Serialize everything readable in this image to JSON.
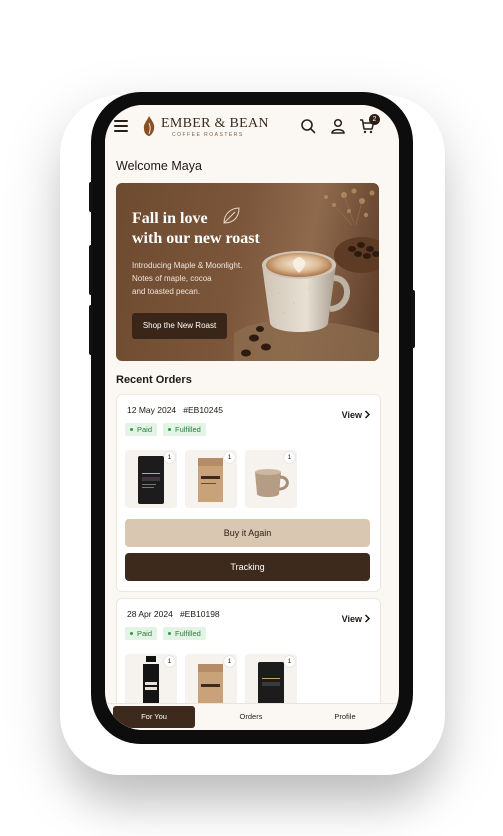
{
  "header": {
    "brand": "EMBER & BEAN",
    "brand_sub": "COFFEE ROASTERS",
    "cart_count": "2",
    "icons": [
      "menu-icon",
      "search-icon",
      "user-icon",
      "cart-icon"
    ]
  },
  "welcome": "Welcome Maya",
  "hero": {
    "title_line1": "Fall in love",
    "title_line2": "with our new roast",
    "desc_line1": "Introducing Maple & Moonlight.",
    "desc_line2": "Notes of maple, cocoa",
    "desc_line3": "and toasted pecan.",
    "button": "Shop the New Roast"
  },
  "recent_orders_title": "Recent Orders",
  "orders": [
    {
      "date": "12 May 2024",
      "number": "#EB10245",
      "view": "View",
      "badges": [
        "Paid",
        "Fulfilled"
      ],
      "items": [
        {
          "qty": "1",
          "label_top": "EMBER & BEAN",
          "label": "MAPLE & MOONLIGHT"
        },
        {
          "qty": "1",
          "label_top": "EMBER & BEAN",
          "label": "OAT LATTE"
        },
        {
          "qty": "1"
        }
      ],
      "buy_again": "Buy it Again",
      "tracking": "Tracking"
    },
    {
      "date": "28 Apr 2024",
      "number": "#EB10198",
      "view": "View",
      "badges": [
        "Paid",
        "Fulfilled"
      ],
      "items": [
        {
          "qty": "1",
          "label_top": "EMBER & BEAN",
          "label": "COLD BREW"
        },
        {
          "qty": "1",
          "label_top": "EMBER & BEAN",
          "label": "HOUSE BLEND"
        },
        {
          "qty": "1",
          "label_top": "EMBER & BEAN",
          "label": "ESPRESSO"
        }
      ]
    }
  ],
  "nav": {
    "for_you": "For You",
    "orders": "Orders",
    "profile": "Profile"
  },
  "colors": {
    "brand_dark": "#3d2a1c",
    "accent_tan": "#d9c7b2",
    "success": "#2e7a3e"
  }
}
